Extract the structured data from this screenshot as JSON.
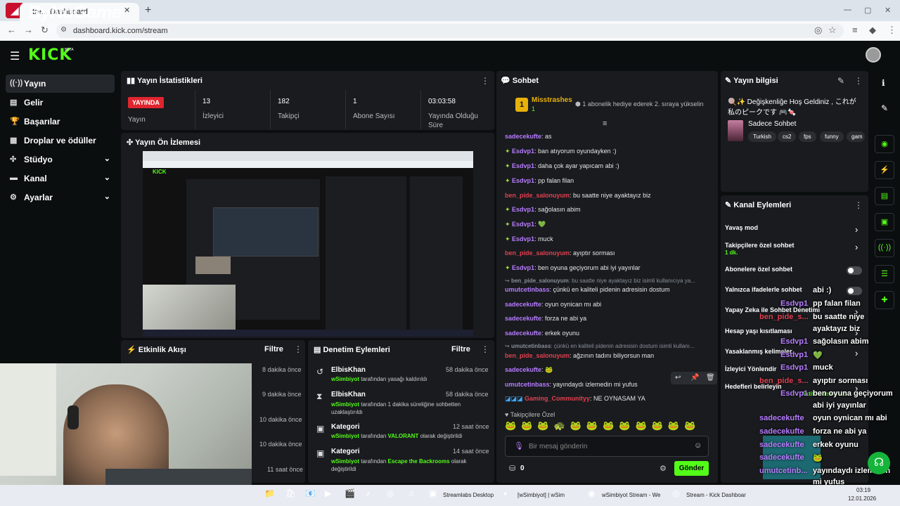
{
  "browser": {
    "tab_title": "tre... Dashboard",
    "url": "dashboard.kick.com/stream",
    "watermark": "ByNoGame"
  },
  "header": {
    "logo": "KICK",
    "beta": "BETA"
  },
  "sidebar": {
    "items": [
      {
        "label": "Yayın",
        "icon": "broadcast-icon"
      },
      {
        "label": "Gelir",
        "icon": "revenue-icon"
      },
      {
        "label": "Başarılar",
        "icon": "trophy-icon"
      },
      {
        "label": "Droplar ve ödüller",
        "icon": "drops-icon"
      },
      {
        "label": "Stüdyo",
        "icon": "studio-icon"
      },
      {
        "label": "Kanal",
        "icon": "channel-icon"
      },
      {
        "label": "Ayarlar",
        "icon": "settings-icon"
      }
    ]
  },
  "stats": {
    "title": "Yayın İstatistikleri",
    "live_badge": "YAYINDA",
    "live_label": "Yayın",
    "items": [
      {
        "value": "13",
        "label": "İzleyici"
      },
      {
        "value": "182",
        "label": "Takipçi"
      },
      {
        "value": "1",
        "label": "Abone Sayısı"
      },
      {
        "value": "03:03:58",
        "label": "Yayında Olduğu Süre"
      }
    ]
  },
  "preview": {
    "title": "Yayın Ön İzlemesi"
  },
  "activity": {
    "title": "Etkinlik Akışı",
    "filter": "Filtre",
    "times": [
      "8 dakika önce",
      "9 dakika önce",
      "10 dakika önce",
      "10 dakika önce",
      "11 saat önce"
    ]
  },
  "moderation": {
    "title": "Denetim Eylemleri",
    "filter": "Filtre",
    "items": [
      {
        "title": "ElbisKhan",
        "time": "58 dakika önce",
        "user": "wSimbiyot",
        "text": " tarafından yasağı kaldırıldı",
        "icon": "undo-icon"
      },
      {
        "title": "ElbisKhan",
        "time": "58 dakika önce",
        "user": "wSimbiyot",
        "text": " tarafından 1 dakika süreliğine sohbetten uzaklaştırıldı",
        "icon": "hourglass-icon"
      },
      {
        "title": "Kategori",
        "time": "12 saat önce",
        "user": "wSimbiyot",
        "text": " tarafından ",
        "hl": "VALORANT",
        "text2": " olarak değiştirildi",
        "icon": "category-icon"
      },
      {
        "title": "Kategori",
        "time": "14 saat önce",
        "user": "wSimbiyot",
        "text": " tarafından ",
        "hl": "Escape the Backrooms",
        "text2": " olarak değiştirildi",
        "icon": "category-icon"
      }
    ]
  },
  "chat": {
    "title": "Sohbet",
    "pinned_user": "Misstrashes",
    "pinned_count": "1",
    "pinned_text": "1 abonelik hediye ederek 2. sıraya yükselin",
    "messages": [
      {
        "user": "sadecekufte",
        "text": ": as",
        "color": "pu",
        "badge": ""
      },
      {
        "user": "Esdvp1",
        "text": ": ban atıyorum oyundayken :)",
        "color": "pu",
        "badge": "✦"
      },
      {
        "user": "Esdvp1",
        "text": ": daha çok ayar yapıcam abi :)",
        "color": "pu",
        "badge": "✦"
      },
      {
        "user": "Esdvp1",
        "text": ": pp falan filan",
        "color": "pu",
        "badge": "✦"
      },
      {
        "user": "ben_pide_salonuyum",
        "text": ": bu saatte niye ayaktayız biz",
        "color": "rd",
        "badge": ""
      },
      {
        "user": "Esdvp1",
        "text": ": sağolasın abim",
        "color": "pu",
        "badge": "✦"
      },
      {
        "user": "Esdvp1",
        "text": ": 💚",
        "color": "pu",
        "badge": "✦"
      },
      {
        "user": "Esdvp1",
        "text": ": muck",
        "color": "pu",
        "badge": "✦"
      },
      {
        "user": "ben_pide_salonuyum",
        "text": ": ayıptır sorması",
        "color": "rd",
        "badge": ""
      },
      {
        "user": "Esdvp1",
        "text": ": ben oyuna geçiyorum abi iyi yayınlar",
        "color": "pu",
        "badge": "✦"
      },
      {
        "user": "ben_pide_salonuyum",
        "text": ": bu saatte niye ayaktayız biz isimli kullanıcıya ya...",
        "color": "gy",
        "badge": "reply"
      },
      {
        "user": "umutcetinbass",
        "text": ": çünkü en kaliteli pidenin adresisin dostum",
        "color": "pu",
        "badge": ""
      },
      {
        "user": "sadecekufte",
        "text": ": oyun oynican mı abi",
        "color": "pu",
        "badge": ""
      },
      {
        "user": "sadecekufte",
        "text": ": forza ne abi ya",
        "color": "pu",
        "badge": ""
      },
      {
        "user": "sadecekufte",
        "text": ": erkek oyunu",
        "color": "pu",
        "badge": ""
      },
      {
        "user": "umutcetinbass",
        "text": ": çünkü en kaliteli pidenin adresisin dostum isimli kullanı...",
        "color": "gy",
        "badge": "reply"
      },
      {
        "user": "ben_pide_salonuyum",
        "text": ": ağzının tadını biliyorsun man",
        "color": "rd",
        "badge": ""
      },
      {
        "user": "sadecekufte",
        "text": ": 🐸",
        "color": "pu",
        "badge": ""
      },
      {
        "user": "umutcetinbass",
        "text": ": yayındaydı izlemedin mi yufus",
        "color": "pu",
        "badge": ""
      },
      {
        "user": "Gaming_Communityy",
        "text": ": NE OYNASAM YA",
        "color": "rd",
        "badge": "multi"
      }
    ],
    "emote_section": "Takipçilere Özel",
    "input_placeholder": "Bir mesaj gönderin",
    "points": "0",
    "send": "Gönder"
  },
  "stream_info": {
    "title": "Yayın bilgisi",
    "stream_title": "🍭✨ Değişkenliğe Hoş Geldiniz , これが私のピークです 🎮🍬",
    "mode": "Sadece Sohbet",
    "tags": [
      "Turkish",
      "cs2",
      "fps",
      "funny",
      "gam"
    ]
  },
  "channel_actions": {
    "title": "Kanal Eylemleri",
    "items": [
      {
        "label": "Yavaş mod",
        "sub": "",
        "control": "chevron"
      },
      {
        "label": "Takipçilere özel sohbet",
        "sub": "1 dk.",
        "control": "chevron"
      },
      {
        "label": "Abonelere özel sohbet",
        "sub": "",
        "control": "toggle"
      },
      {
        "label": "Yalnızca ifadelerle sohbet",
        "sub": "",
        "control": "toggle"
      },
      {
        "label": "Yapay Zeka ile Sohbet Denetimi",
        "sub": "",
        "control": "chevron"
      },
      {
        "label": "Hesap yaşı kısıtlaması",
        "sub": "",
        "control": "chevron"
      },
      {
        "label": "Yasaklanmış kelimeler",
        "sub": "",
        "control": "chevron"
      },
      {
        "label": "İzleyici Yönlendir",
        "sub": "",
        "control": "none"
      },
      {
        "label": "Hedefleri belirleyin",
        "sub": "Aktif hedefler - 2",
        "control": "chevron"
      }
    ]
  },
  "overlay": {
    "lines": [
      {
        "user": "",
        "text": "abi :)"
      },
      {
        "user": "Esdvp1",
        "text": "pp falan filan"
      },
      {
        "user": "ben_pide_s...",
        "text": "bu saatte niye"
      },
      {
        "user": "",
        "text": "ayaktayız biz"
      },
      {
        "user": "Esdvp1",
        "text": "sağolasın abim"
      },
      {
        "user": "Esdvp1",
        "text": "💚"
      },
      {
        "user": "Esdvp1",
        "text": "muck"
      },
      {
        "user": "ben_pide_s...",
        "text": "ayıptır sorması"
      },
      {
        "user": "Esdvp1",
        "text": "ben oyuna geçiyorum"
      },
      {
        "user": "",
        "text": "abi iyi yayınlar"
      },
      {
        "user": "sadecekufte",
        "text": "oyun oynican mı abi"
      },
      {
        "user": "sadecekufte",
        "text": "forza ne abi ya"
      },
      {
        "user": "sadecekufte",
        "text": "erkek oyunu"
      },
      {
        "user": "sadecekufte",
        "text": "🐸"
      },
      {
        "user": "umutcetinb...",
        "text": "yayındaydı izlemedin"
      },
      {
        "user": "",
        "text": "mi yufus"
      },
      {
        "user": "Gaming_Co...",
        "text": "NE OYNASAM YA"
      }
    ]
  },
  "taskbar": {
    "apps": [
      {
        "label": "Streamlabs Desktop"
      },
      {
        "label": "[wSimbiyot] | wSim"
      },
      {
        "label": "wSimbiyot Stream - We"
      },
      {
        "label": "Stream - Kick Dashboar"
      }
    ],
    "time": "03:19",
    "date": "12.01.2026"
  }
}
